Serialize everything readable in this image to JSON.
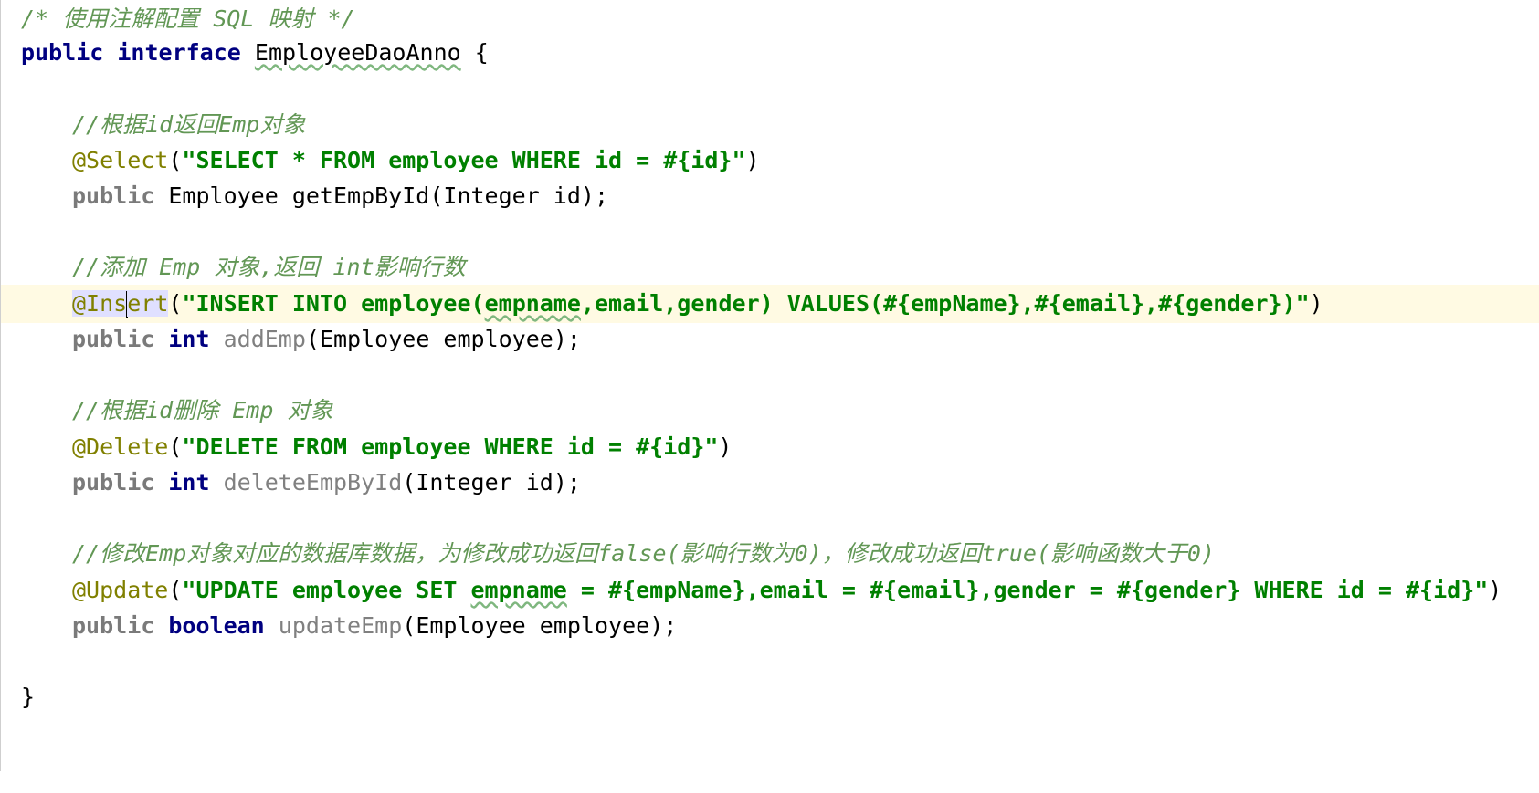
{
  "editor": {
    "lines": {
      "l1_comment": "/* 使用注解配置 SQL 映射 */",
      "l2_kw1": "public",
      "l2_kw2": "interface",
      "l2_name": "EmployeeDaoAnno",
      "l2_brace": " {",
      "l4_comment": "//根据id返回Emp对象",
      "l5_anno": "@Select",
      "l5_open": "(",
      "l5_str": "\"SELECT * FROM employee WHERE id = #{id}\"",
      "l5_close": ")",
      "l6_kw": "public",
      "l6_rest": " Employee getEmpById(Integer id);",
      "l8_comment": "//添加 Emp 对象,返回 int影响行数",
      "l9_anno_a": "@Ins",
      "l9_anno_b": "e",
      "l9_anno_c": "rt",
      "l9_open": "(",
      "l9_str_a": "\"INSERT INTO employee(",
      "l9_str_b": "empname",
      "l9_str_c": ",email,gender) VALUES(#{empName},#{email},#{gender})\"",
      "l9_close": ")",
      "l10_kw1": "public",
      "l10_kw2": "int",
      "l10_method": "addEmp",
      "l10_rest": "(Employee employee);",
      "l12_comment": "//根据id删除 Emp 对象",
      "l13_anno": "@Delete",
      "l13_open": "(",
      "l13_str": "\"DELETE FROM employee WHERE id = #{id}\"",
      "l13_close": ")",
      "l14_kw1": "public",
      "l14_kw2": "int",
      "l14_method": "deleteEmpById",
      "l14_rest": "(Integer id);",
      "l16_comment": "//修改Emp对象对应的数据库数据，为修改成功返回false(影响行数为0)，修改成功返回true(影响函数大于0)",
      "l17_anno": "@Update",
      "l17_open": "(",
      "l17_str_a": "\"UPDATE employee SET ",
      "l17_str_b": "empname",
      "l17_str_c": " = #{empName},email = #{email},gender = #{gender} WHERE id = #{id}\"",
      "l17_close": ")",
      "l18_kw1": "public",
      "l18_kw2": "boolean",
      "l18_method": "updateEmp",
      "l18_rest": "(Employee employee);",
      "l20_brace": "}"
    },
    "colors": {
      "keyword": "#000080",
      "string": "#008000",
      "annotation": "#808000",
      "comment": "#629755",
      "unused": "#808080",
      "current_line": "#fffae3"
    }
  }
}
